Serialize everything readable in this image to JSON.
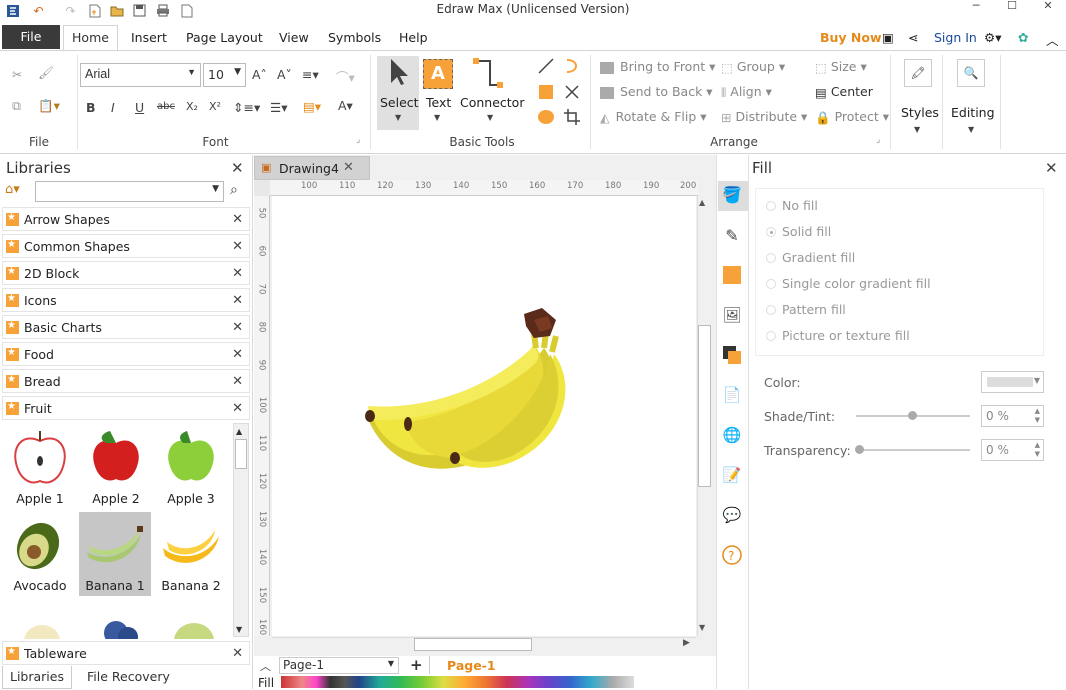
{
  "window": {
    "title": "Edraw Max (Unlicensed Version)"
  },
  "menu": {
    "file": "File",
    "tabs": [
      "Home",
      "Insert",
      "Page Layout",
      "View",
      "Symbols",
      "Help"
    ],
    "buy_now": "Buy Now",
    "sign_in": "Sign In"
  },
  "font": {
    "family": "Arial",
    "size": "10"
  },
  "groups": {
    "file": "File",
    "font": "Font",
    "basic_tools": "Basic Tools",
    "arrange": "Arrange"
  },
  "tools": {
    "select": "Select",
    "text": "Text",
    "connector": "Connector",
    "styles": "Styles",
    "editing": "Editing"
  },
  "arrange": {
    "bring_front": "Bring to Front",
    "send_back": "Send to Back",
    "rotate_flip": "Rotate & Flip",
    "group": "Group",
    "align": "Align",
    "distribute": "Distribute",
    "size": "Size",
    "center": "Center",
    "protect": "Protect"
  },
  "libraries": {
    "title": "Libraries",
    "items": [
      "Arrow Shapes",
      "Common Shapes",
      "2D Block",
      "Icons",
      "Basic Charts",
      "Food",
      "Bread",
      "Fruit"
    ],
    "fruits": [
      "Apple 1",
      "Apple 2",
      "Apple 3",
      "Avocado",
      "Banana 1",
      "Banana 2"
    ],
    "bottom_item": "Tableware",
    "bottom_tabs": [
      "Libraries",
      "File Recovery"
    ]
  },
  "document": {
    "tab": "Drawing4",
    "page_select": "Page-1",
    "page_tab": "Page-1",
    "fill_label": "Fill"
  },
  "ruler": {
    "h": [
      "100",
      "110",
      "120",
      "130",
      "140",
      "150",
      "160",
      "170",
      "180",
      "190",
      "200"
    ],
    "v": [
      "50",
      "60",
      "70",
      "80",
      "90",
      "100",
      "110",
      "120",
      "130",
      "140",
      "150",
      "160"
    ]
  },
  "fill": {
    "title": "Fill",
    "options": [
      "No fill",
      "Solid fill",
      "Gradient fill",
      "Single color gradient fill",
      "Pattern fill",
      "Picture or texture fill"
    ],
    "color_label": "Color:",
    "shade_label": "Shade/Tint:",
    "shade_value": "0 %",
    "transparency_label": "Transparency:",
    "transparency_value": "0 %"
  },
  "colors": {
    "accent": "#f7a238",
    "banana": "#f0e640",
    "banana_shadow": "#d8cc30",
    "stem": "#5a2a1a"
  }
}
